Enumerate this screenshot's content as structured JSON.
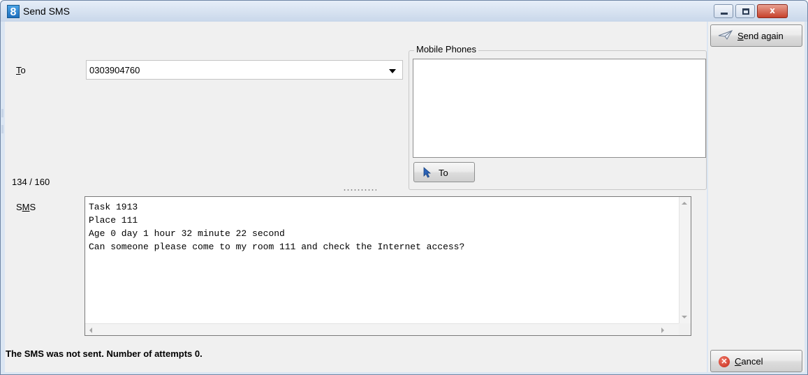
{
  "window": {
    "title": "Send SMS",
    "app_icon_glyph": "8",
    "controls": [
      "minimize-icon",
      "maximize-icon",
      "close-icon"
    ],
    "close_glyph": "x"
  },
  "form": {
    "to_label_accel": "T",
    "to_label_rest": "o",
    "to_value": "0303904760",
    "mobile_phones_label": "Mobile Phones",
    "to_button_label": "To",
    "counter": "134 / 160",
    "sms_label_s": "S",
    "sms_label_m": "M",
    "sms_label_rest": "S",
    "sms_lines": [
      "Task 1913",
      "Place 111",
      "Age 0 day 1 hour 32 minute 22 second",
      "Can someone please come to my room 111 and check the Internet access?"
    ]
  },
  "status": {
    "message": "The SMS was not sent. Number of attempts 0."
  },
  "actions": {
    "send_again_accel": "S",
    "send_again_rest": "end again",
    "cancel_accel": "C",
    "cancel_rest": "ancel",
    "cancel_icon_glyph": "✕"
  },
  "colors": {
    "window_frame": "#dbe6f3",
    "panel": "#f0f0f0",
    "close_button": "#c6412b"
  }
}
